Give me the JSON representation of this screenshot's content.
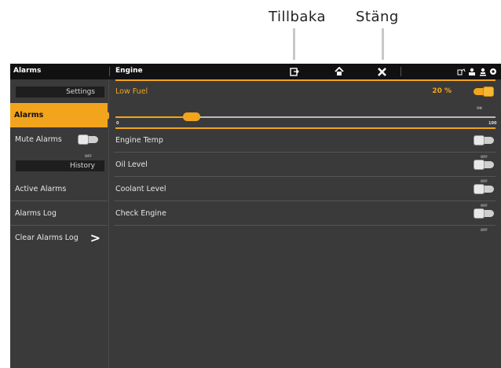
{
  "callouts": {
    "back": "Tillbaka",
    "close": "Stäng"
  },
  "topbar": {
    "left_title": "Alarms",
    "mid_title": "Engine",
    "icons": [
      "back-icon",
      "home-icon",
      "close-icon",
      "fuel-pump-icon",
      "person-icon",
      "gps-icon",
      "gear-icon"
    ]
  },
  "left": {
    "settings_header": "Settings",
    "active_item": "Alarms",
    "mute_label": "Mute Alarms",
    "mute_state": "OFF",
    "history_header": "History",
    "active_alarms": "Active Alarms",
    "alarms_log": "Alarms Log",
    "clear_log": "Clear Alarms Log",
    "clear_chevron": ">"
  },
  "main": {
    "low_fuel_label": "Low Fuel",
    "low_fuel_pct": "20 %",
    "low_fuel_state": "ON",
    "slider": {
      "value": 20,
      "min": 0,
      "max": 100,
      "min_label": "0",
      "max_label": "100"
    },
    "rows": [
      {
        "label": "Engine Temp",
        "state": "OFF"
      },
      {
        "label": "Oil Level",
        "state": "OFF"
      },
      {
        "label": "Coolant Level",
        "state": "OFF"
      },
      {
        "label": "Check Engine",
        "state": "OFF"
      }
    ]
  },
  "colors": {
    "accent": "#f2a41c",
    "panel": "#3a3a3a",
    "topbar": "#111111"
  }
}
